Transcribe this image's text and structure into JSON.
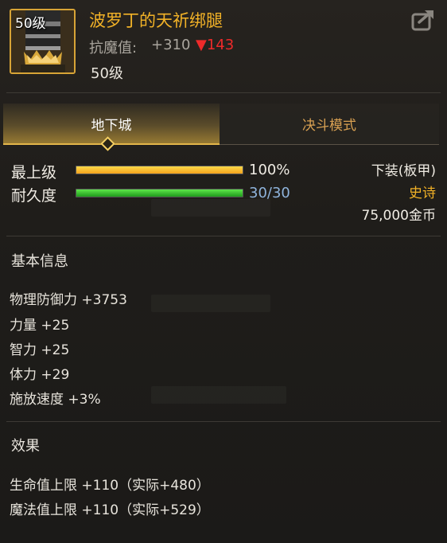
{
  "item": {
    "level_badge": "50级",
    "name": "波罗丁的天祈绑腿",
    "resist_label": "抗魔值:",
    "resist_value": "+310",
    "resist_diff": "▼143",
    "required_level": "50级"
  },
  "tabs": [
    {
      "label": "地下城",
      "active": true
    },
    {
      "label": "决斗模式",
      "active": false
    }
  ],
  "stats": {
    "max_level_label": "最上级",
    "max_level_value": "100%",
    "max_level_fill": 1.0,
    "durability_label": "耐久度",
    "durability_value": "30/30",
    "durability_fill": 1.0,
    "slot": "下装(板甲)",
    "rarity": "史诗",
    "price": "75,000金币"
  },
  "basic_info": {
    "title": "基本信息",
    "lines": [
      "物理防御力 +3753",
      "力量 +25",
      "智力 +25",
      "体力 +29",
      "施放速度 +3%"
    ]
  },
  "effects": {
    "title": "效果",
    "lines": [
      "生命值上限 +110（实际+480）",
      "魔法值上限 +110（实际+529）"
    ]
  },
  "colors": {
    "accent": "#f2b227",
    "negative": "#ee2a2a",
    "durability_text": "#8fb4dc"
  },
  "icons": [
    "share-icon",
    "leggings-icon"
  ]
}
